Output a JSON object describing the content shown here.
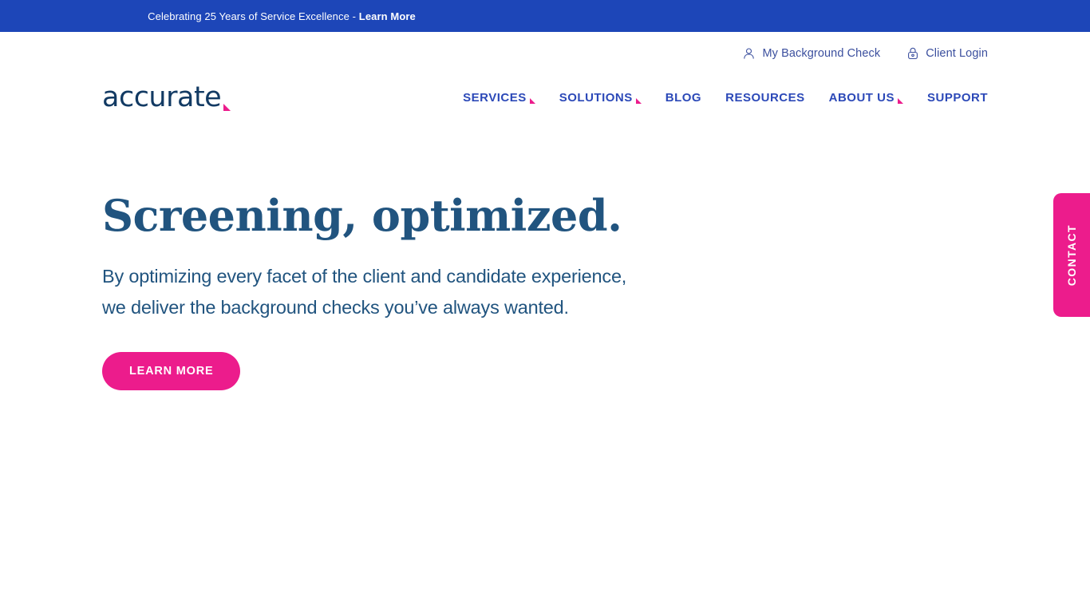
{
  "announcement": {
    "text": "Celebrating 25 Years of Service Excellence - ",
    "link_label": "Learn More"
  },
  "header": {
    "logo_text": "accurate",
    "utility_links": [
      {
        "label": "My Background Check",
        "icon": "person-icon"
      },
      {
        "label": "Client Login",
        "icon": "lock-icon"
      }
    ],
    "nav_items": [
      {
        "label": "SERVICES",
        "has_dropdown": true
      },
      {
        "label": "SOLUTIONS",
        "has_dropdown": true
      },
      {
        "label": "BLOG",
        "has_dropdown": false
      },
      {
        "label": "RESOURCES",
        "has_dropdown": false
      },
      {
        "label": "ABOUT US",
        "has_dropdown": true
      },
      {
        "label": "SUPPORT",
        "has_dropdown": false
      }
    ]
  },
  "hero": {
    "title": "Screening, optimized.",
    "subtitle_line1": "By optimizing every facet of the client and candidate experience,",
    "subtitle_line2": "we deliver the background checks you’ve always wanted.",
    "cta_label": "LEARN MORE"
  },
  "contact_tab": {
    "label": "CONTACT"
  },
  "colors": {
    "banner_blue": "#1d46b8",
    "nav_blue": "#2c49b8",
    "brand_pink": "#ec1c8c",
    "hero_blue": "#21547f",
    "logo_navy": "#123a63",
    "utility_blue": "#3b4f9e"
  }
}
